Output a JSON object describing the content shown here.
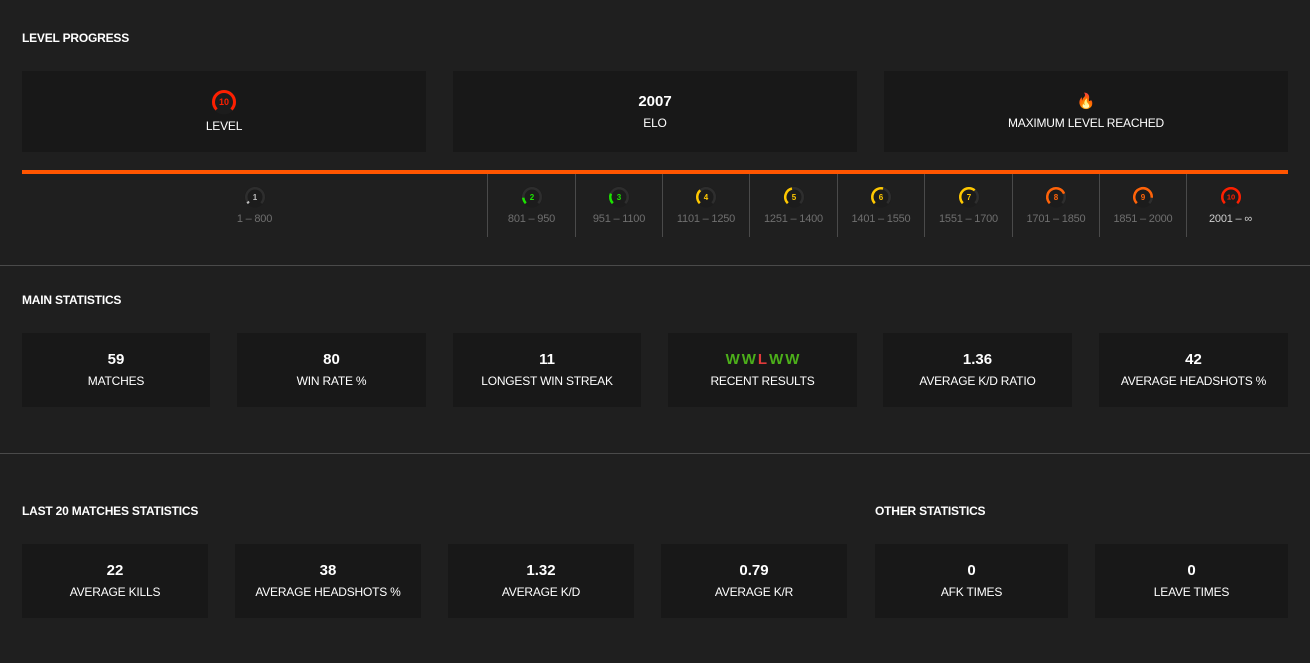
{
  "level_progress": {
    "title": "LEVEL PROGRESS",
    "cards": {
      "level": {
        "value": "10",
        "label": "LEVEL",
        "icon": "skill-level-10-icon"
      },
      "elo": {
        "value": "2007",
        "label": "ELO"
      },
      "max": {
        "icon": "fire-icon",
        "icon_glyph": "🔥",
        "label": "MAXIMUM LEVEL REACHED"
      }
    },
    "progress_fraction": 1.0,
    "accent_color": "#ff5500",
    "levels": [
      {
        "level": "1",
        "range": "1 – 800",
        "color": "#cfcfcf",
        "fill": 0.05
      },
      {
        "level": "2",
        "range": "801 – 950",
        "color": "#1ce400",
        "fill": 0.15
      },
      {
        "level": "3",
        "range": "951 – 1100",
        "color": "#1ce400",
        "fill": 0.25
      },
      {
        "level": "4",
        "range": "1101 – 1250",
        "color": "#ffc800",
        "fill": 0.35
      },
      {
        "level": "5",
        "range": "1251 – 1400",
        "color": "#ffc800",
        "fill": 0.45
      },
      {
        "level": "6",
        "range": "1401 – 1550",
        "color": "#ffc800",
        "fill": 0.55
      },
      {
        "level": "7",
        "range": "1551 – 1700",
        "color": "#ffc800",
        "fill": 0.65
      },
      {
        "level": "8",
        "range": "1701 – 1850",
        "color": "#ff6309",
        "fill": 0.75
      },
      {
        "level": "9",
        "range": "1851 – 2000",
        "color": "#ff6309",
        "fill": 0.85
      },
      {
        "level": "10",
        "range": "2001 – ∞",
        "color": "#fe1f00",
        "fill": 1.0,
        "current": true
      }
    ]
  },
  "main_statistics": {
    "title": "MAIN STATISTICS",
    "cards": [
      {
        "value": "59",
        "label": "MATCHES"
      },
      {
        "value": "80",
        "label": "WIN RATE %"
      },
      {
        "value": "11",
        "label": "LONGEST WIN STREAK"
      },
      {
        "value": "",
        "label": "RECENT RESULTS"
      },
      {
        "value": "1.36",
        "label": "AVERAGE K/D RATIO"
      },
      {
        "value": "42",
        "label": "AVERAGE HEADSHOTS %"
      }
    ],
    "recent_results": [
      "W",
      "W",
      "L",
      "W",
      "W"
    ],
    "win_color": "#4caf1a",
    "loss_color": "#e03a3a"
  },
  "last20": {
    "title": "LAST 20 MATCHES STATISTICS",
    "cards": [
      {
        "value": "22",
        "label": "AVERAGE KILLS"
      },
      {
        "value": "38",
        "label": "AVERAGE HEADSHOTS %"
      },
      {
        "value": "1.32",
        "label": "AVERAGE K/D"
      },
      {
        "value": "0.79",
        "label": "AVERAGE K/R"
      }
    ]
  },
  "other": {
    "title": "OTHER STATISTICS",
    "cards": [
      {
        "value": "0",
        "label": "AFK TIMES"
      },
      {
        "value": "0",
        "label": "LEAVE TIMES"
      }
    ]
  }
}
